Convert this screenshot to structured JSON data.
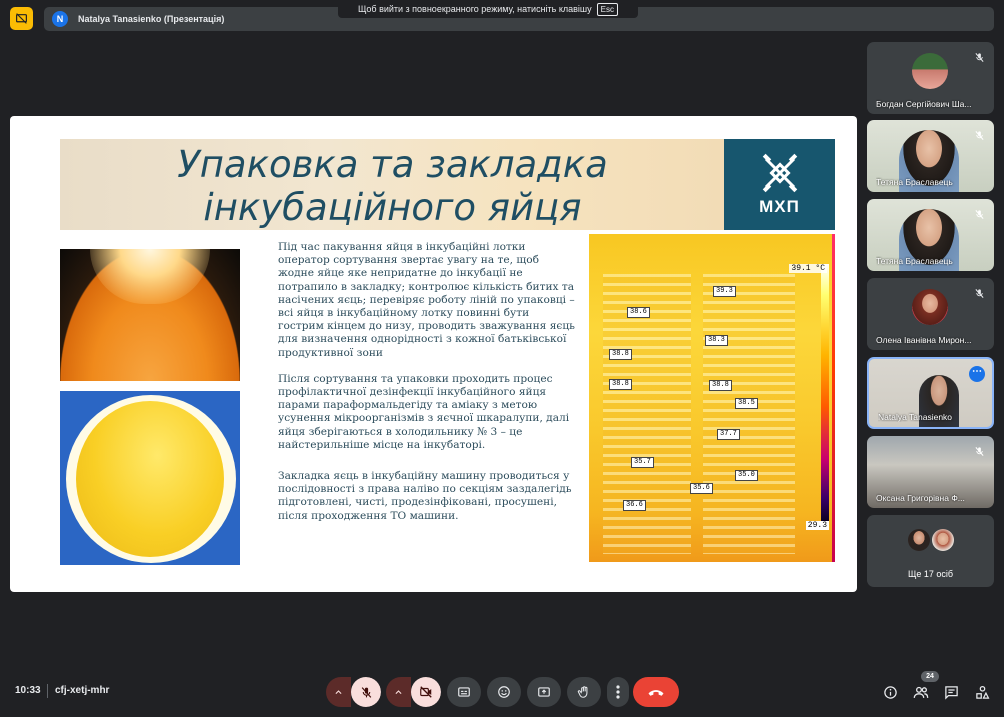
{
  "window": {
    "presenter_initial": "N",
    "presenter_label": "Natalya Tanasienko (Презентація)",
    "fullscreen_hint": "Щоб вийти з повноекранного режиму, натисніть клавішу",
    "fullscreen_key": "Esc"
  },
  "slide": {
    "title_line1": "Упаковка та закладка",
    "title_line2": "інкубаційного яйця",
    "logo_text": "МХП",
    "paragraph1": "Під час пакування яйця в інкубаційні лотки оператор сортування звертає увагу на те, щоб жодне яйце яке непридатне до інкубації не потрапило в закладку; контролює кількість битих та насічених яєць; перевіряє роботу ліній по упаковці – всі яйця в інкубаційному лотку повинні бути гострим кінцем до низу, проводить зважування яєць для визначення однорідності з кожної батьківської  продуктивної зони",
    "paragraph2": "Після сортування та упаковки проходить процес профілактичної дезінфекції інкубаційного яйця парами параформальдегіду та аміаку з метою усунення мікроорганізмів з яєчної шкаралупи, далі яйця зберігаються в холодильнику № 3 – це найстерильніше місце на інкубаторі.",
    "paragraph3": "Закладка яєць в інкубаційну машину проводиться у послідовності з права наліво по секціям заздалегідь підготовлені, чисті, продезінфіковані, просушені, після проходження ТО машини.",
    "thermal": {
      "max_label": "39.1 °C",
      "min_label": "29.3",
      "readings": [
        "39.3",
        "38.6",
        "38.3",
        "38.8",
        "38.8",
        "38.8",
        "38.5",
        "37.7",
        "35.7",
        "35.0",
        "35.6",
        "36.6"
      ]
    }
  },
  "participants": [
    {
      "name": "Богдан Сергійович Ша...",
      "muted": true
    },
    {
      "name": "Тетяна Браславець",
      "muted": true
    },
    {
      "name": "Тетяна Браславець",
      "muted": true
    },
    {
      "name": "Олена Іванівна Мирон...",
      "muted": true
    },
    {
      "name": "Natalya Tanasienko",
      "muted": false
    },
    {
      "name": "Оксана Григорівна Ф...",
      "muted": true
    }
  ],
  "more_participants_label": "Ще 17 осіб",
  "bottom_bar": {
    "time": "10:33",
    "meeting_code": "cfj-xetj-mhr",
    "participants_count": "24"
  },
  "colors": {
    "background": "#202124",
    "end_call": "#ea4335",
    "muted_control": "#f9dedc",
    "accent_blue": "#1a73e8",
    "slide_title": "#1f4e63",
    "logo_bg": "#17566e"
  }
}
